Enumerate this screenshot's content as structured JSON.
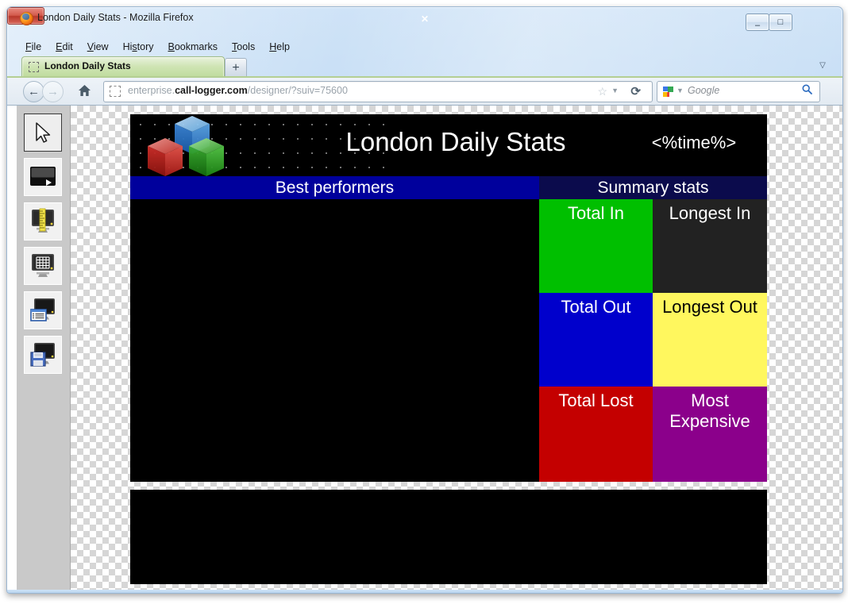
{
  "window": {
    "title": "London Daily Stats - Mozilla Firefox",
    "icon": "firefox-logo",
    "controls": {
      "minimize": "–",
      "maximize": "□",
      "close": "✕"
    }
  },
  "menubar": {
    "items": [
      {
        "pre": "",
        "key": "F",
        "post": "ile"
      },
      {
        "pre": "",
        "key": "E",
        "post": "dit"
      },
      {
        "pre": "",
        "key": "V",
        "post": "iew"
      },
      {
        "pre": "Hi",
        "key": "s",
        "post": "tory"
      },
      {
        "pre": "",
        "key": "B",
        "post": "ookmarks"
      },
      {
        "pre": "",
        "key": "T",
        "post": "ools"
      },
      {
        "pre": "",
        "key": "H",
        "post": "elp"
      }
    ]
  },
  "tabs": {
    "active_label": "London Daily Stats",
    "new_tab_label": "+",
    "list_all_label": "▽"
  },
  "navbar": {
    "back_label": "←",
    "forward_label": "→",
    "home_label": "⌂",
    "url_prefix": "enterprise.",
    "url_domain": "call-logger.com",
    "url_suffix": "/designer/?suiv=75600",
    "url_full": "enterprise.call-logger.com/designer/?suiv=75600",
    "bookmark_label": "☆",
    "bookmark_caret": "▼",
    "reload_label": "⟳",
    "search_placeholder": "Google",
    "search_caret": "▼",
    "search_go_label": "⚲"
  },
  "toolbox": {
    "items": [
      {
        "name": "select-tool",
        "glyph": "cursor",
        "selected": true
      },
      {
        "name": "play-screen-tool",
        "glyph": "play-screen",
        "selected": false
      },
      {
        "name": "measure-screen-tool",
        "glyph": "ruler-screen",
        "selected": false
      },
      {
        "name": "grid-screen-tool",
        "glyph": "grid-screen",
        "selected": false
      },
      {
        "name": "list-screen-tool",
        "glyph": "list-screen",
        "selected": false
      },
      {
        "name": "save-screen-tool",
        "glyph": "floppy-screen",
        "selected": false
      }
    ]
  },
  "board": {
    "header": {
      "title": "London Daily Stats",
      "time_token": "<%time%>",
      "logo": "rgb-cubes-logo"
    },
    "section_bars": [
      {
        "label": "Best performers",
        "color": "#00009c"
      },
      {
        "label": "Summary stats",
        "color": "#0b0b4c"
      }
    ],
    "tiles": [
      {
        "label": "Total In",
        "bg": "#00bf00",
        "fg": "#ffffff"
      },
      {
        "label": "Longest In",
        "bg": "#222222",
        "fg": "#ffffff"
      },
      {
        "label": "Total Out",
        "bg": "#0000cc",
        "fg": "#ffffff"
      },
      {
        "label": "Longest Out",
        "bg": "#fff75e",
        "fg": "#000000"
      },
      {
        "label": "Total Lost",
        "bg": "#c40000",
        "fg": "#ffffff"
      },
      {
        "label": "Most Expensive",
        "bg": "#8b008b",
        "fg": "#ffffff"
      }
    ]
  }
}
